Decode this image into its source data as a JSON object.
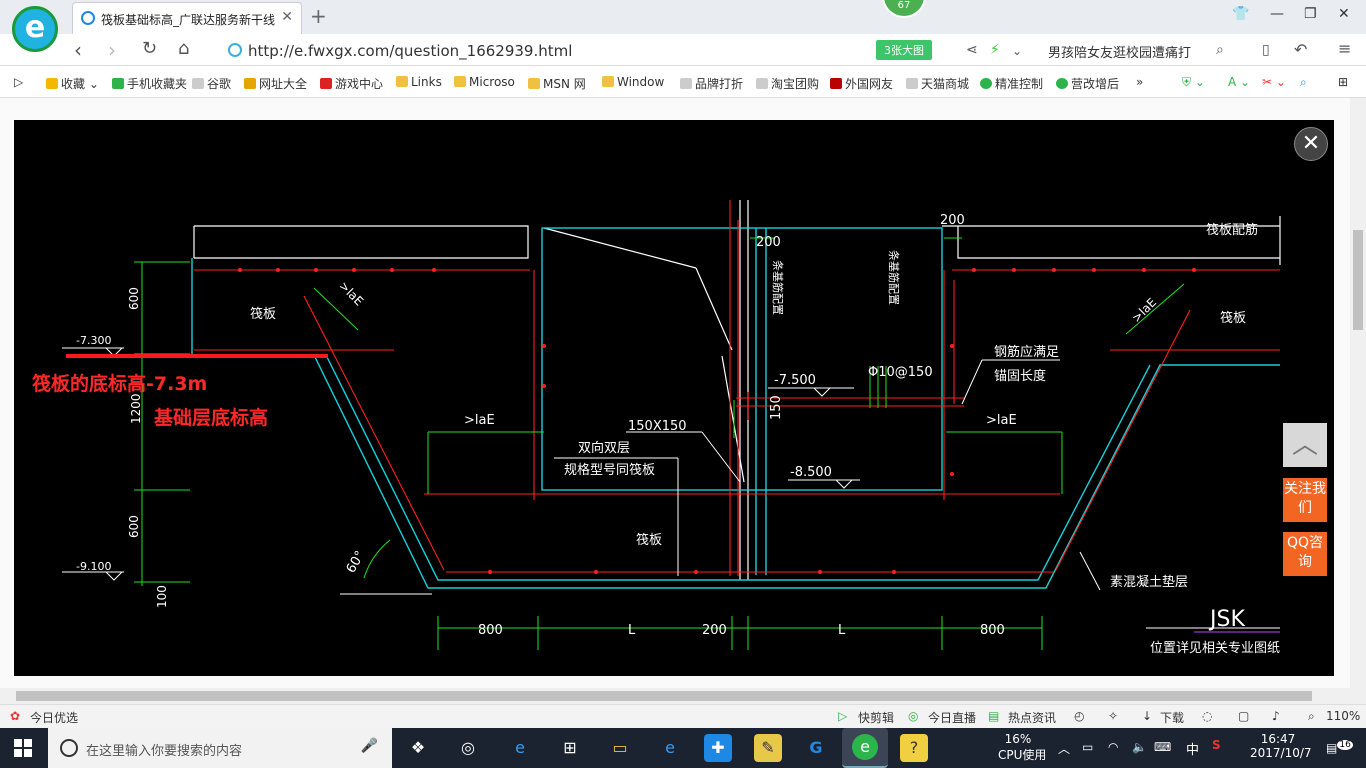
{
  "browser": {
    "tab_title": "筏板基础标高_广联达服务新干线",
    "badge": "67",
    "url": "http://e.fwxgx.com/question_1662939.html",
    "bigpic_label": "3张大图",
    "headline": "男孩陪女友逛校园遭痛打"
  },
  "bookmarks": [
    {
      "label": "收藏",
      "color": "#f5b800"
    },
    {
      "label": "手机收藏夹",
      "color": "#2db34a"
    },
    {
      "label": "谷歌",
      "color": "#bbbbbb"
    },
    {
      "label": "网址大全",
      "color": "#e6a400"
    },
    {
      "label": "游戏中心",
      "color": "#d22"
    },
    {
      "label": "Links",
      "color": "#f0c040"
    },
    {
      "label": "Microso",
      "color": "#f0c040"
    },
    {
      "label": "MSN 网",
      "color": "#f0c040"
    },
    {
      "label": "Window",
      "color": "#f0c040"
    },
    {
      "label": "品牌打折",
      "color": "#bbbbbb"
    },
    {
      "label": "淘宝团购",
      "color": "#bbbbbb"
    },
    {
      "label": "外国网友",
      "color": "#b00"
    },
    {
      "label": "天猫商城",
      "color": "#bbbbbb"
    },
    {
      "label": "精准控制",
      "color": "#2db34a"
    },
    {
      "label": "营改增后",
      "color": "#2db34a"
    }
  ],
  "drawing": {
    "labels": {
      "raft_left": "筏板",
      "raft_right": "筏板",
      "raft_bottom": "筏板",
      "raft_rebar": "筏板配筋",
      "d600a": "600",
      "d1200": "1200",
      "d600b": "600",
      "d100": "100",
      "el_7300": "-7.300",
      "el_9100": "-9.100",
      "el_7500": "-7.500",
      "el_8500": "-8.500",
      "lae1": ">laE",
      "lae2": ">laE",
      "lae3": ">laE",
      "lae4": ">laE",
      "d200a": "200",
      "d200b": "200",
      "d150": "150",
      "phi": "Φ10@150",
      "sec": "150X150",
      "rebar_req1": "钢筋应满足",
      "rebar_req2": "锚固长度",
      "dbl1": "双向双层",
      "dbl2": "规格型号同筏板",
      "angle": "60°",
      "concrete": "素混凝土垫层",
      "jsk": "JSK",
      "ref": "位置详见相关专业图纸",
      "v1": "条基筋配置",
      "v2": "条基筋配置",
      "dim800a": "800",
      "dimL1": "L",
      "dim200": "200",
      "dimL2": "L",
      "dim800b": "800"
    },
    "annotation1": "筏板的底标高-7.3m",
    "annotation2": "基础层底标高"
  },
  "side": {
    "follow": "关注我们",
    "qq": "QQ咨询"
  },
  "statusbar": {
    "left": "今日优选",
    "kuaijian": "快剪辑",
    "live": "今日直播",
    "news": "热点资讯",
    "download": "下载",
    "zoom": "110%"
  },
  "taskbar": {
    "search_placeholder": "在这里输入你要搜索的内容",
    "cpu": "16%",
    "cpu_label": "CPU使用",
    "ime": "中",
    "time": "16:47",
    "date": "2017/10/7",
    "notif": "16"
  }
}
